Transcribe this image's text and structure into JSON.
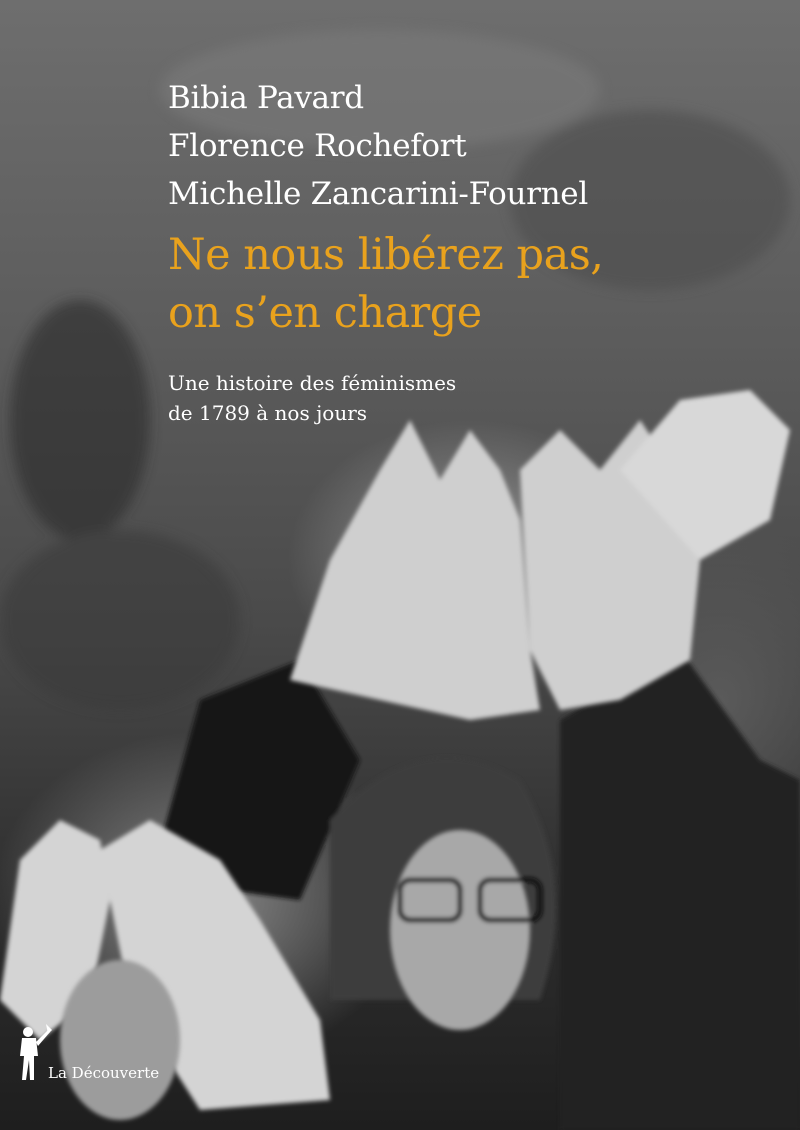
{
  "authors": [
    "Bibia Pavard",
    "Florence Rochefort",
    "Michelle Zancarini-Fournel"
  ],
  "title_lines": [
    "Ne nous libérez pas,",
    "on s’en charge"
  ],
  "subtitle_lines": [
    "Une histoire des féminismes",
    "de 1789 à nos jours"
  ],
  "publisher": {
    "name": "La Découverte",
    "logo_icon": "publisher-figure-icon"
  },
  "colors": {
    "title": "#e9a21d",
    "text": "#ffffff"
  }
}
